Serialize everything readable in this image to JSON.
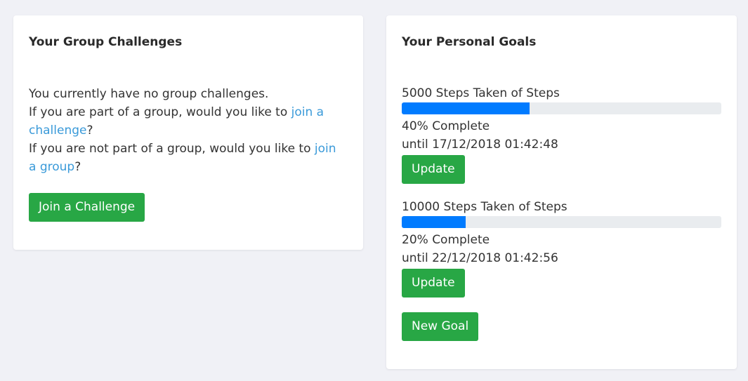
{
  "group": {
    "title": "Your Group Challenges",
    "line1": "You currently have no group challenges.",
    "line2_prefix": "If you are part of a group, would you like to ",
    "line2_link": "join a challenge",
    "line2_suffix": "?",
    "line3_prefix": "If you are not part of a group, would you like to ",
    "line3_link": "join a group",
    "line3_suffix": "?",
    "join_button": "Join a Challenge"
  },
  "goals": {
    "title": "Your Personal Goals",
    "items": [
      {
        "label": "5000 Steps Taken of Steps",
        "progress_percent": 40,
        "complete_text": "40% Complete",
        "until_text": "until 17/12/2018 01:42:48",
        "button": "Update"
      },
      {
        "label": "10000 Steps Taken of Steps",
        "progress_percent": 20,
        "complete_text": "20% Complete",
        "until_text": "until 22/12/2018 01:42:56",
        "button": "Update"
      }
    ],
    "new_goal_button": "New Goal"
  },
  "colors": {
    "accent_green": "#28a745",
    "progress_blue": "#007bff",
    "link_blue": "#3a9ad9",
    "background": "#f0f1f6"
  }
}
